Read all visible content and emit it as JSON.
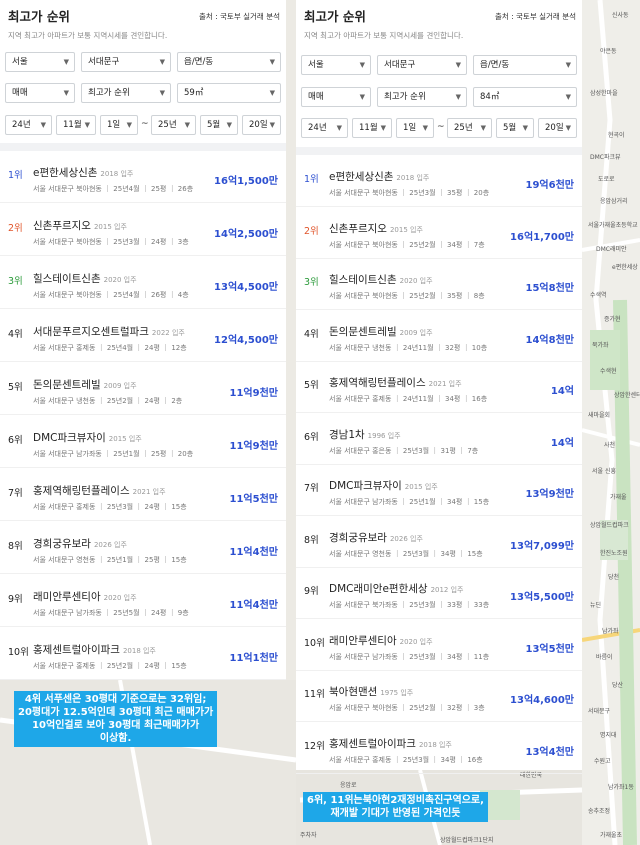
{
  "map": {
    "labels": [
      "신사동",
      "야은동",
      "삼성한마을",
      "현곡이",
      "DMC파크뷰",
      "도로로",
      "응암삼거리",
      "서울가재울초등학교",
      "DMC래미안",
      "e편한세상",
      "수색역",
      "증가현",
      "북가좌",
      "수색현",
      "상암한센터",
      "새마을회",
      "사천",
      "서울 신흥",
      "가재울",
      "상암월드컵파크",
      "한진노조원",
      "당천",
      "뉴딘",
      "남가좌",
      "바름이",
      "당산",
      "서대문구",
      "명지대",
      "수원고",
      "남가좌1동",
      "송추조정",
      "가재울초",
      "응암로",
      "DMC래미안e편한세상",
      "수색교",
      "대한민국",
      "주차자",
      "상암월드컵파크1단지"
    ]
  },
  "panels": [
    {
      "id": "left",
      "title": "최고가 순위",
      "source": "출처 : 국토부 실거래 분석",
      "desc": "지역 최고가 아파트가 보통 지역시세를 견인합니다.",
      "filters": {
        "sido": "서울",
        "gu": "서대문구",
        "dong": "읍/면/동",
        "trade": "매매",
        "sort": "최고가 순위",
        "size": "59㎡",
        "from_year": "24년",
        "from_month": "11월",
        "from_day": "1일",
        "tilde": "~",
        "to_year": "25년",
        "to_month": "5월",
        "to_day": "20일"
      },
      "items": [
        {
          "rank": "1위",
          "name": "e편한세상신촌",
          "year": "2018 입주",
          "meta": "서울 서대문구 북아현동 ｜ 25년4월 ｜ 25평 ｜ 26층",
          "price": "16억1,500만"
        },
        {
          "rank": "2위",
          "name": "신촌푸르지오",
          "year": "2015 입주",
          "meta": "서울 서대문구 북아현동 ｜ 25년3월 ｜ 24평 ｜ 3층",
          "price": "14억2,500만"
        },
        {
          "rank": "3위",
          "name": "힐스테이트신촌",
          "year": "2020 입주",
          "meta": "서울 서대문구 북아현동 ｜ 25년4월 ｜ 26평 ｜ 4층",
          "price": "13억4,500만"
        },
        {
          "rank": "4위",
          "name": "서대문푸르지오센트럴파크",
          "year": "2022 입주",
          "meta": "서울 서대문구 홍제동 ｜ 25년4월 ｜ 24평 ｜ 12층",
          "price": "12억4,500만"
        },
        {
          "rank": "5위",
          "name": "돈의문센트레빌",
          "year": "2009 입주",
          "meta": "서울 서대문구 냉천동 ｜ 25년2월 ｜ 24평 ｜ 2층",
          "price": "11억9천만"
        },
        {
          "rank": "6위",
          "name": "DMC파크뷰자이",
          "year": "2015 입주",
          "meta": "서울 서대문구 남가좌동 ｜ 25년1월 ｜ 25평 ｜ 20층",
          "price": "11억9천만"
        },
        {
          "rank": "7위",
          "name": "홍제역해링턴플레이스",
          "year": "2021 입주",
          "meta": "서울 서대문구 홍제동 ｜ 25년3월 ｜ 24평 ｜ 15층",
          "price": "11억5천만"
        },
        {
          "rank": "8위",
          "name": "경희궁유보라",
          "year": "2026 입주",
          "meta": "서울 서대문구 영천동 ｜ 25년1월 ｜ 25평 ｜ 15층",
          "price": "11억4천만"
        },
        {
          "rank": "9위",
          "name": "래미안루센티아",
          "year": "2020 입주",
          "meta": "서울 서대문구 남가좌동 ｜ 25년5월 ｜ 24평 ｜ 9층",
          "price": "11억4천만"
        },
        {
          "rank": "10위",
          "name": "홍제센트럴아이파크",
          "year": "2018 입주",
          "meta": "서울 서대문구 홍제동 ｜ 25년2월 ｜ 24평 ｜ 15층",
          "price": "11억1천만"
        }
      ]
    },
    {
      "id": "right",
      "title": "최고가 순위",
      "source": "출처 : 국토부 실거래 분석",
      "desc": "지역 최고가 아파트가 보통 지역시세를 견인합니다.",
      "filters": {
        "sido": "서울",
        "gu": "서대문구",
        "dong": "읍/면/동",
        "trade": "매매",
        "sort": "최고가 순위",
        "size": "84㎡",
        "from_year": "24년",
        "from_month": "11월",
        "from_day": "1일",
        "tilde": "~",
        "to_year": "25년",
        "to_month": "5월",
        "to_day": "20일"
      },
      "items": [
        {
          "rank": "1위",
          "name": "e편한세상신촌",
          "year": "2018 입주",
          "meta": "서울 서대문구 북아현동 ｜ 25년3월 ｜ 35평 ｜ 20층",
          "price": "19억6천만"
        },
        {
          "rank": "2위",
          "name": "신촌푸르지오",
          "year": "2015 입주",
          "meta": "서울 서대문구 북아현동 ｜ 25년2월 ｜ 34평 ｜ 7층",
          "price": "16억1,700만"
        },
        {
          "rank": "3위",
          "name": "힐스테이트신촌",
          "year": "2020 입주",
          "meta": "서울 서대문구 북아현동 ｜ 25년2월 ｜ 35평 ｜ 8층",
          "price": "15억8천만"
        },
        {
          "rank": "4위",
          "name": "돈의문센트레빌",
          "year": "2009 입주",
          "meta": "서울 서대문구 냉천동 ｜ 24년11월 ｜ 32평 ｜ 10층",
          "price": "14억8천만"
        },
        {
          "rank": "5위",
          "name": "홍제역해링턴플레이스",
          "year": "2021 입주",
          "meta": "서울 서대문구 홍제동 ｜ 24년11월 ｜ 34평 ｜ 16층",
          "price": "14억"
        },
        {
          "rank": "6위",
          "name": "경남1차",
          "year": "1996 입주",
          "meta": "서울 서대문구 홍은동 ｜ 25년3월 ｜ 31평 ｜ 7층",
          "price": "14억"
        },
        {
          "rank": "7위",
          "name": "DMC파크뷰자이",
          "year": "2015 입주",
          "meta": "서울 서대문구 남가좌동 ｜ 25년1월 ｜ 34평 ｜ 15층",
          "price": "13억9천만"
        },
        {
          "rank": "8위",
          "name": "경희궁유보라",
          "year": "2026 입주",
          "meta": "서울 서대문구 영천동 ｜ 25년3월 ｜ 34평 ｜ 15층",
          "price": "13억7,099만"
        },
        {
          "rank": "9위",
          "name": "DMC래미안e편한세상",
          "year": "2012 입주",
          "meta": "서울 서대문구 북가좌동 ｜ 25년3월 ｜ 33평 ｜ 33층",
          "price": "13억5,500만"
        },
        {
          "rank": "10위",
          "name": "래미안루센티아",
          "year": "2020 입주",
          "meta": "서울 서대문구 남가좌동 ｜ 25년3월 ｜ 34평 ｜ 11층",
          "price": "13억5천만"
        },
        {
          "rank": "11위",
          "name": "북아현맨션",
          "year": "1975 입주",
          "meta": "서울 서대문구 북아현동 ｜ 25년2월 ｜ 32평 ｜ 3층",
          "price": "13억4,600만"
        },
        {
          "rank": "12위",
          "name": "홍제센트럴아이파크",
          "year": "2018 입주",
          "meta": "서울 서대문구 홍제동 ｜ 25년3월 ｜ 34평 ｜ 16층",
          "price": "13억4천만"
        }
      ]
    }
  ],
  "rank_colors": {
    "1위": "#2c4fd0",
    "2위": "#e0542a",
    "3위": "#2b9a3a",
    "default": "#222222"
  },
  "notes": {
    "left": [
      "4위 서푸센은 30평대 기준으로는 32위임;",
      "20평대가 12.5억인데 30평대 최근 매매가가",
      "10억인걸로 보아 30평대 최근매매가가",
      "이상함."
    ],
    "right": [
      "6위, 11위는북아현2재정비촉진구역으로,",
      "재개발 기대가 반영된 가격인듯"
    ]
  }
}
